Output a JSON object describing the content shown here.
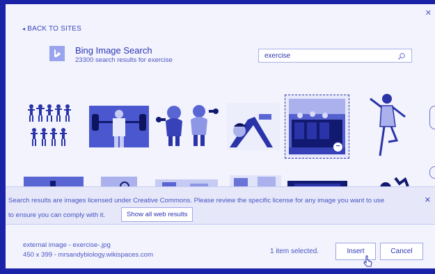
{
  "nav": {
    "back_label": "BACK TO SITES"
  },
  "provider": {
    "name": "Bing Image Search",
    "result_count": "23300 search results for exercise"
  },
  "search": {
    "value": "exercise",
    "icon": "search-icon"
  },
  "notice": {
    "line1": "Search results are images licensed under Creative Commons. Please review the specific license for any image you want to use",
    "line2": "to ensure you can comply with it.",
    "show_all_label": "Show all web results"
  },
  "footer": {
    "file_name": "external image - exercise-.jpg",
    "file_info": "450 x 399 - mrsandybiology.wikispaces.com",
    "selection_status": "1 item selected.",
    "insert_label": "Insert",
    "cancel_label": "Cancel"
  },
  "colors": {
    "accent": "#2a33a8",
    "background": "#f2f3fd",
    "frame": "#1a23a8"
  }
}
